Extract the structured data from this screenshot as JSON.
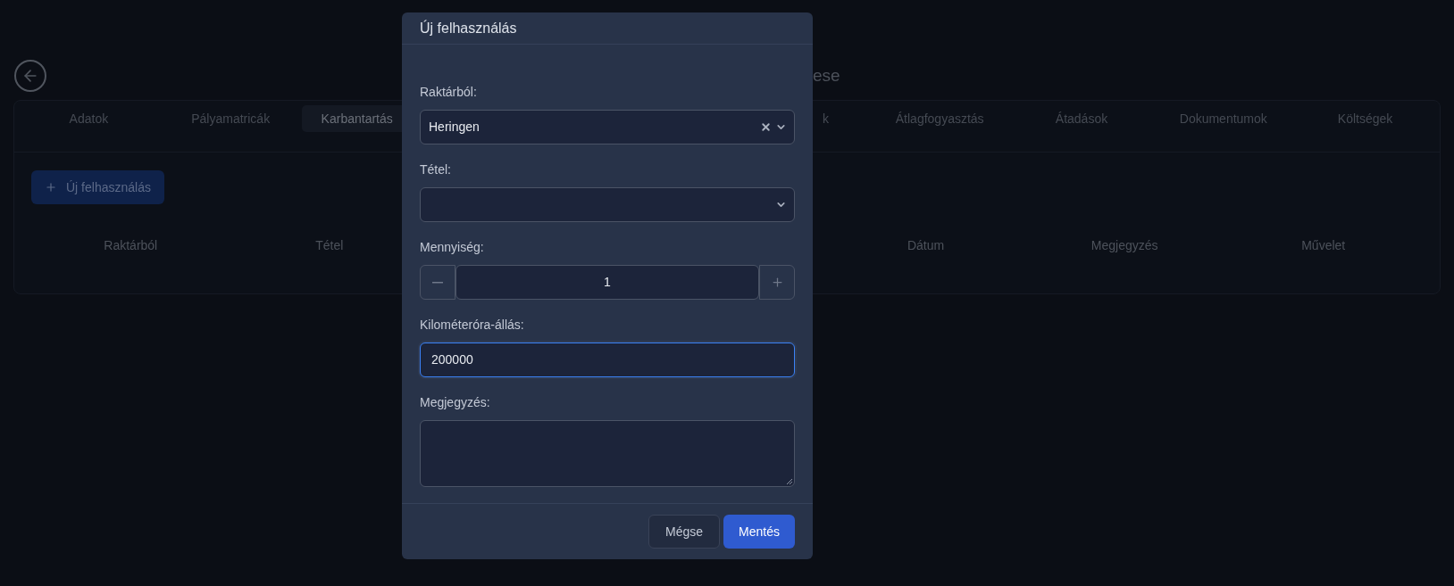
{
  "page": {
    "title": "ese",
    "tabs": [
      {
        "label": "Adatok",
        "selected": false
      },
      {
        "label": "Pályamatricák",
        "selected": false
      },
      {
        "label": "Karbantartás",
        "selected": true
      },
      {
        "label": "k",
        "selected": false
      },
      {
        "label": "Átlagfogyasztás",
        "selected": false
      },
      {
        "label": "Átadások",
        "selected": false
      },
      {
        "label": "Dokumentumok",
        "selected": false
      },
      {
        "label": "Költségek",
        "selected": false
      }
    ],
    "new_button": "Új felhasználás",
    "table": {
      "columns": [
        "Raktárból",
        "Tétel",
        "Dátum",
        "Megjegyzés",
        "Művelet"
      ]
    }
  },
  "dialog": {
    "title": "Új felhasználás",
    "fields": [
      {
        "kind": "select",
        "label": "Raktárból:",
        "value": "Heringen",
        "clearable": true
      },
      {
        "kind": "select",
        "label": "Tétel:"
      },
      {
        "kind": "stepper",
        "label": "Mennyiség:",
        "value": "1"
      },
      {
        "kind": "text",
        "label": "Kilométeróra-állás:",
        "value": "200000",
        "focused": true
      },
      {
        "kind": "textarea",
        "label": "Megjegyzés:",
        "focused": false
      }
    ],
    "buttons": [
      {
        "label": "Mégse",
        "kind": "secondary"
      },
      {
        "label": "Mentés",
        "kind": "primary"
      }
    ]
  }
}
